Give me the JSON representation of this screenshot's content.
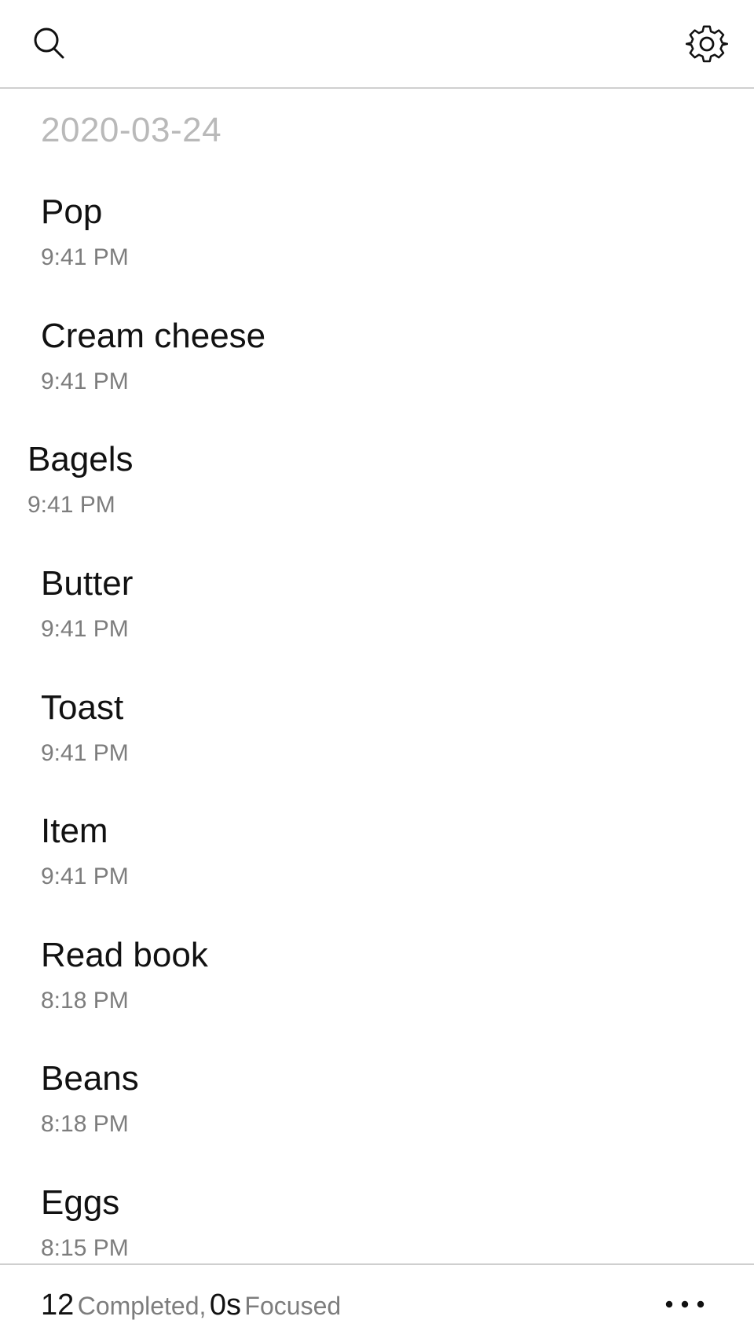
{
  "toolbar": {
    "search_icon": "search-icon",
    "settings_icon": "gear-icon"
  },
  "list": {
    "date_header": "2020-03-24",
    "items": [
      {
        "title": "Pop",
        "time": "9:41 PM"
      },
      {
        "title": "Cream cheese",
        "time": "9:41 PM"
      },
      {
        "title": "Bagels",
        "time": "9:41 PM"
      },
      {
        "title": "Butter",
        "time": "9:41 PM"
      },
      {
        "title": "Toast",
        "time": "9:41 PM"
      },
      {
        "title": "Item",
        "time": "9:41 PM"
      },
      {
        "title": "Read book",
        "time": "8:18 PM"
      },
      {
        "title": "Beans",
        "time": "8:18 PM"
      },
      {
        "title": "Eggs",
        "time": "8:15 PM"
      }
    ]
  },
  "footer": {
    "completed_count": "12",
    "completed_label": "Completed,",
    "focused_value": "0s",
    "focused_label": "Focused",
    "more_icon": "more-dots-icon"
  },
  "colors": {
    "text": "#111111",
    "secondary": "#7d7d7d",
    "date_header": "#b9b9b9",
    "divider": "#cfcfcf"
  }
}
